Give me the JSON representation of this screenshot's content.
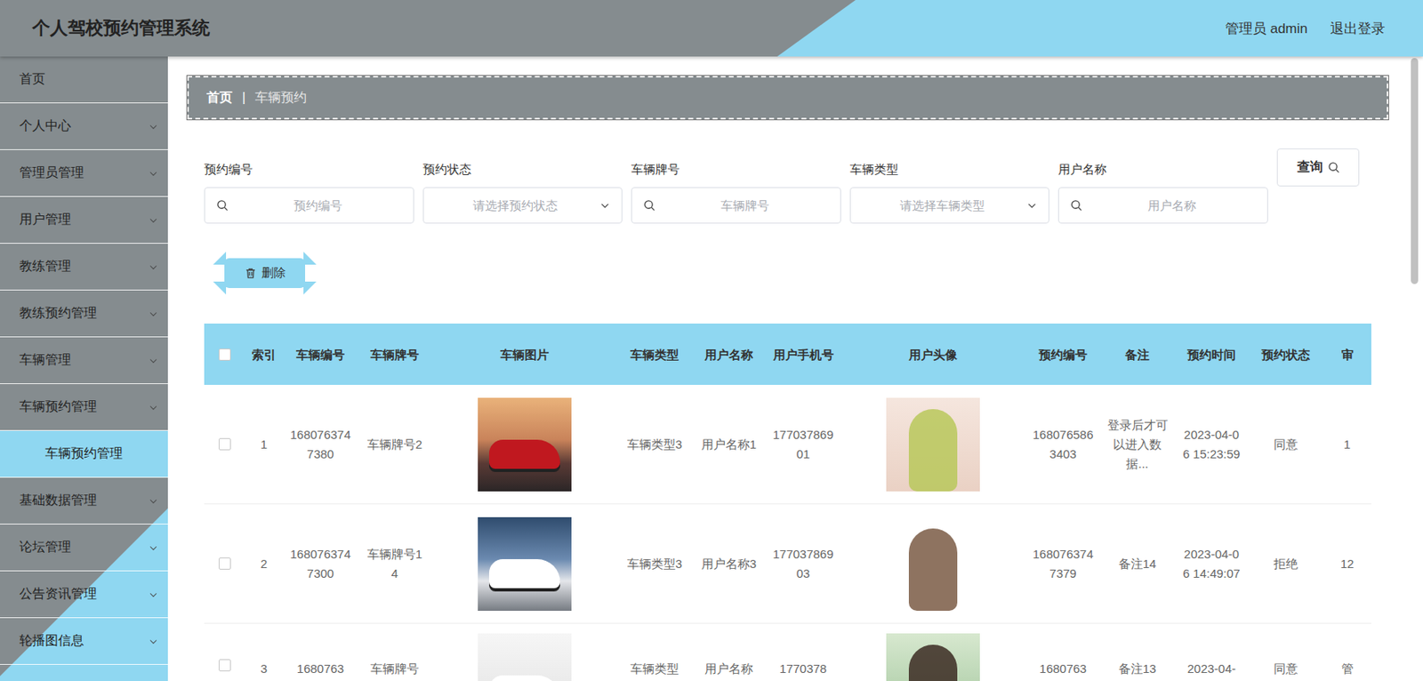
{
  "header": {
    "title": "个人驾校预约管理系统",
    "user": "管理员 admin",
    "logout": "退出登录"
  },
  "sidebar": {
    "items": [
      {
        "label": "首页",
        "kind": "link"
      },
      {
        "label": "个人中心",
        "kind": "group",
        "expanded": false
      },
      {
        "label": "管理员管理",
        "kind": "group",
        "expanded": false
      },
      {
        "label": "用户管理",
        "kind": "group",
        "expanded": false
      },
      {
        "label": "教练管理",
        "kind": "group",
        "expanded": false
      },
      {
        "label": "教练预约管理",
        "kind": "group",
        "expanded": false
      },
      {
        "label": "车辆管理",
        "kind": "group",
        "expanded": false
      },
      {
        "label": "车辆预约管理",
        "kind": "group",
        "expanded": true,
        "children": [
          {
            "label": "车辆预约管理",
            "selected": true
          }
        ]
      },
      {
        "label": "基础数据管理",
        "kind": "group",
        "expanded": false
      },
      {
        "label": "论坛管理",
        "kind": "group",
        "expanded": false
      },
      {
        "label": "公告资讯管理",
        "kind": "group",
        "expanded": false
      },
      {
        "label": "轮播图信息",
        "kind": "group",
        "expanded": false
      }
    ]
  },
  "breadcrumb": {
    "items": [
      "首页",
      "车辆预约"
    ],
    "separator": "|"
  },
  "search": {
    "fields": [
      {
        "label": "预约编号",
        "placeholder": "预约编号",
        "kind": "text"
      },
      {
        "label": "预约状态",
        "placeholder": "请选择预约状态",
        "kind": "select"
      },
      {
        "label": "车辆牌号",
        "placeholder": "车辆牌号",
        "kind": "text"
      },
      {
        "label": "车辆类型",
        "placeholder": "请选择车辆类型",
        "kind": "select"
      },
      {
        "label": "用户名称",
        "placeholder": "用户名称",
        "kind": "text"
      }
    ],
    "button": "查询"
  },
  "actions": {
    "delete": "删除"
  },
  "table": {
    "all_checked": false,
    "columns": [
      {
        "label": "索引",
        "kind": "text"
      },
      {
        "label": "车辆编号",
        "kind": "text"
      },
      {
        "label": "车辆牌号",
        "kind": "text"
      },
      {
        "label": "车辆图片",
        "kind": "image"
      },
      {
        "label": "车辆类型",
        "kind": "text"
      },
      {
        "label": "用户名称",
        "kind": "text"
      },
      {
        "label": "用户手机号",
        "kind": "text"
      },
      {
        "label": "用户头像",
        "kind": "image"
      },
      {
        "label": "预约编号",
        "kind": "text"
      },
      {
        "label": "备注",
        "kind": "text"
      },
      {
        "label": "预约时间",
        "kind": "text"
      },
      {
        "label": "预约状态",
        "kind": "text"
      },
      {
        "label": "审",
        "kind": "text"
      }
    ],
    "rows": [
      {
        "checked": false,
        "cells": [
          "1",
          "1680763747380",
          "车辆牌号2",
          "车辆类型3",
          "用户名称1",
          "17703786901",
          "1680765863403",
          "登录后才可以进入数据...",
          "2023-04-06 15:23:59",
          "同意",
          "1"
        ]
      },
      {
        "checked": false,
        "cells": [
          "2",
          "1680763747300",
          "车辆牌号14",
          "车辆类型3",
          "用户名称3",
          "17703786903",
          "1680763747379",
          "备注14",
          "2023-04-06 14:49:07",
          "拒绝",
          "12"
        ]
      },
      {
        "checked": false,
        "cells": [
          "3",
          "1680763",
          "车辆牌号",
          "车辆类型",
          "用户名称",
          "1770378",
          "1680763",
          "备注13",
          "2023-04-",
          "同意",
          "管"
        ]
      }
    ]
  }
}
